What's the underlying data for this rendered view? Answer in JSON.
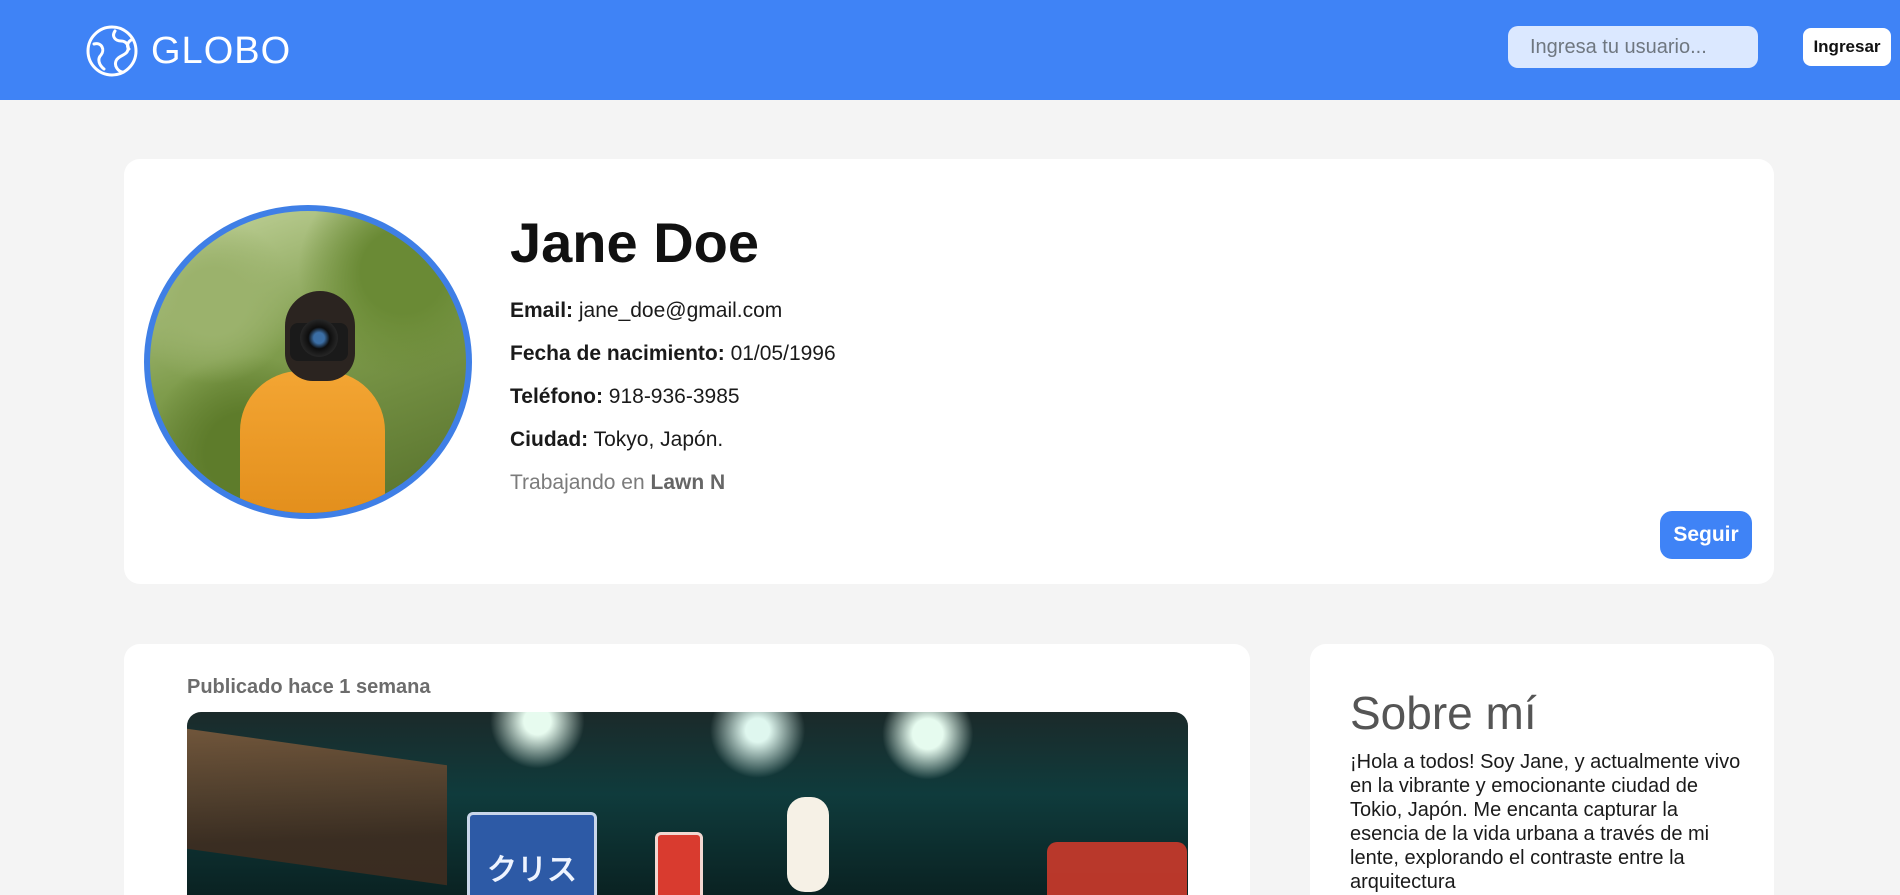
{
  "header": {
    "brand": "GLOBO",
    "search": {
      "placeholder": "Ingresa tu usuario...",
      "value": ""
    },
    "login_label": "Ingresar"
  },
  "profile": {
    "name": "Jane Doe",
    "email_label": "Email:",
    "email": "jane_doe@gmail.com",
    "birth_label": "Fecha de nacimiento:",
    "birth": "01/05/1996",
    "phone_label": "Teléfono:",
    "phone": "918-936-3985",
    "city_label": "Ciudad:",
    "city": "Tokyo, Japón.",
    "working_prefix": "Trabajando en",
    "company": "Lawn N",
    "follow_label": "Seguir"
  },
  "post": {
    "published": "Publicado hace 1 semana",
    "image_sign_text": "クリス"
  },
  "about": {
    "title": "Sobre mí",
    "text": "¡Hola a todos! Soy Jane, y actualmente vivo en la vibrante y emocionante ciudad de Tokio, Japón. Me encanta capturar la esencia de la vida urbana a través de mi lente, explorando el contraste entre la arquitectura"
  },
  "colors": {
    "primary": "#3f83f6",
    "background": "#f4f4f4",
    "card": "#ffffff"
  },
  "icons": {
    "logo": "globe-icon"
  }
}
